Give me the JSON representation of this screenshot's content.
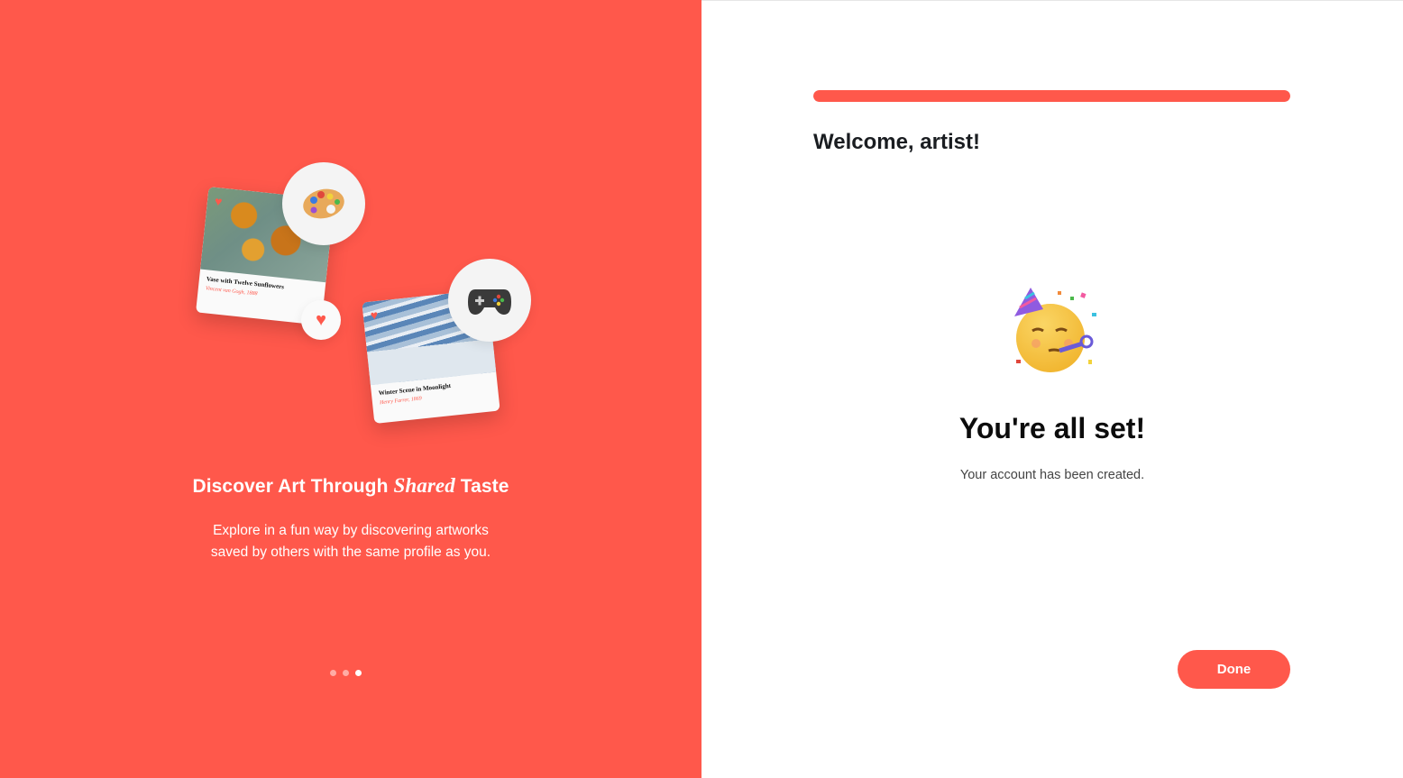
{
  "colors": {
    "accent": "#ff584b",
    "heading": "#1a1d21",
    "muted": "#444444"
  },
  "left": {
    "cards": [
      {
        "title": "Vase with Twelve Sunflowers",
        "artist": "Vincent van Gogh, 1888"
      },
      {
        "title": "Winter Scene in Moonlight",
        "artist": "Henry Farrer, 1869"
      }
    ],
    "icons": [
      "palette-icon",
      "gamepad-icon",
      "heart-icon"
    ],
    "title_before": "Discover Art Through ",
    "title_emphasis": "Shared",
    "title_after": " Taste",
    "description": "Explore in a fun way by discovering artworks saved by others with the same profile as you.",
    "pagination": {
      "count": 3,
      "active_index": 2
    }
  },
  "right": {
    "progress": 1.0,
    "welcome": "Welcome, artist!",
    "celebration_icon": "party-face-icon",
    "title": "You're all set!",
    "subtitle": "Your account has been created.",
    "done_label": "Done"
  }
}
